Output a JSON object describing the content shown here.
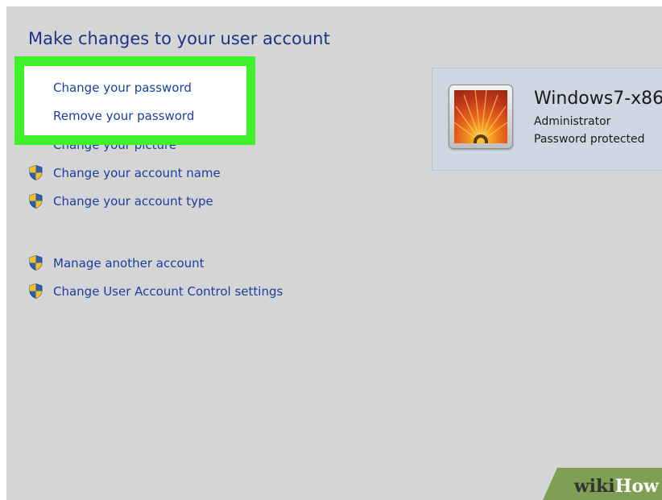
{
  "page": {
    "title": "Make changes to your user account"
  },
  "tasks": [
    {
      "label": "Change your password",
      "shield": false
    },
    {
      "label": "Remove your password",
      "shield": false
    },
    {
      "label": "Change your picture",
      "shield": false
    },
    {
      "label": "Change your account name",
      "shield": true
    },
    {
      "label": "Change your account type",
      "shield": true
    },
    {
      "label": "Manage another account",
      "shield": true
    },
    {
      "label": "Change User Account Control settings",
      "shield": true
    }
  ],
  "account": {
    "name": "Windows7-x86",
    "role": "Administrator",
    "status": "Password protected"
  },
  "watermark": {
    "wiki": "wiki",
    "how": "How"
  },
  "colors": {
    "link": "#1a3f9e",
    "title": "#1e3287",
    "highlight": "#3ff12a",
    "background": "#d5d5d5"
  }
}
